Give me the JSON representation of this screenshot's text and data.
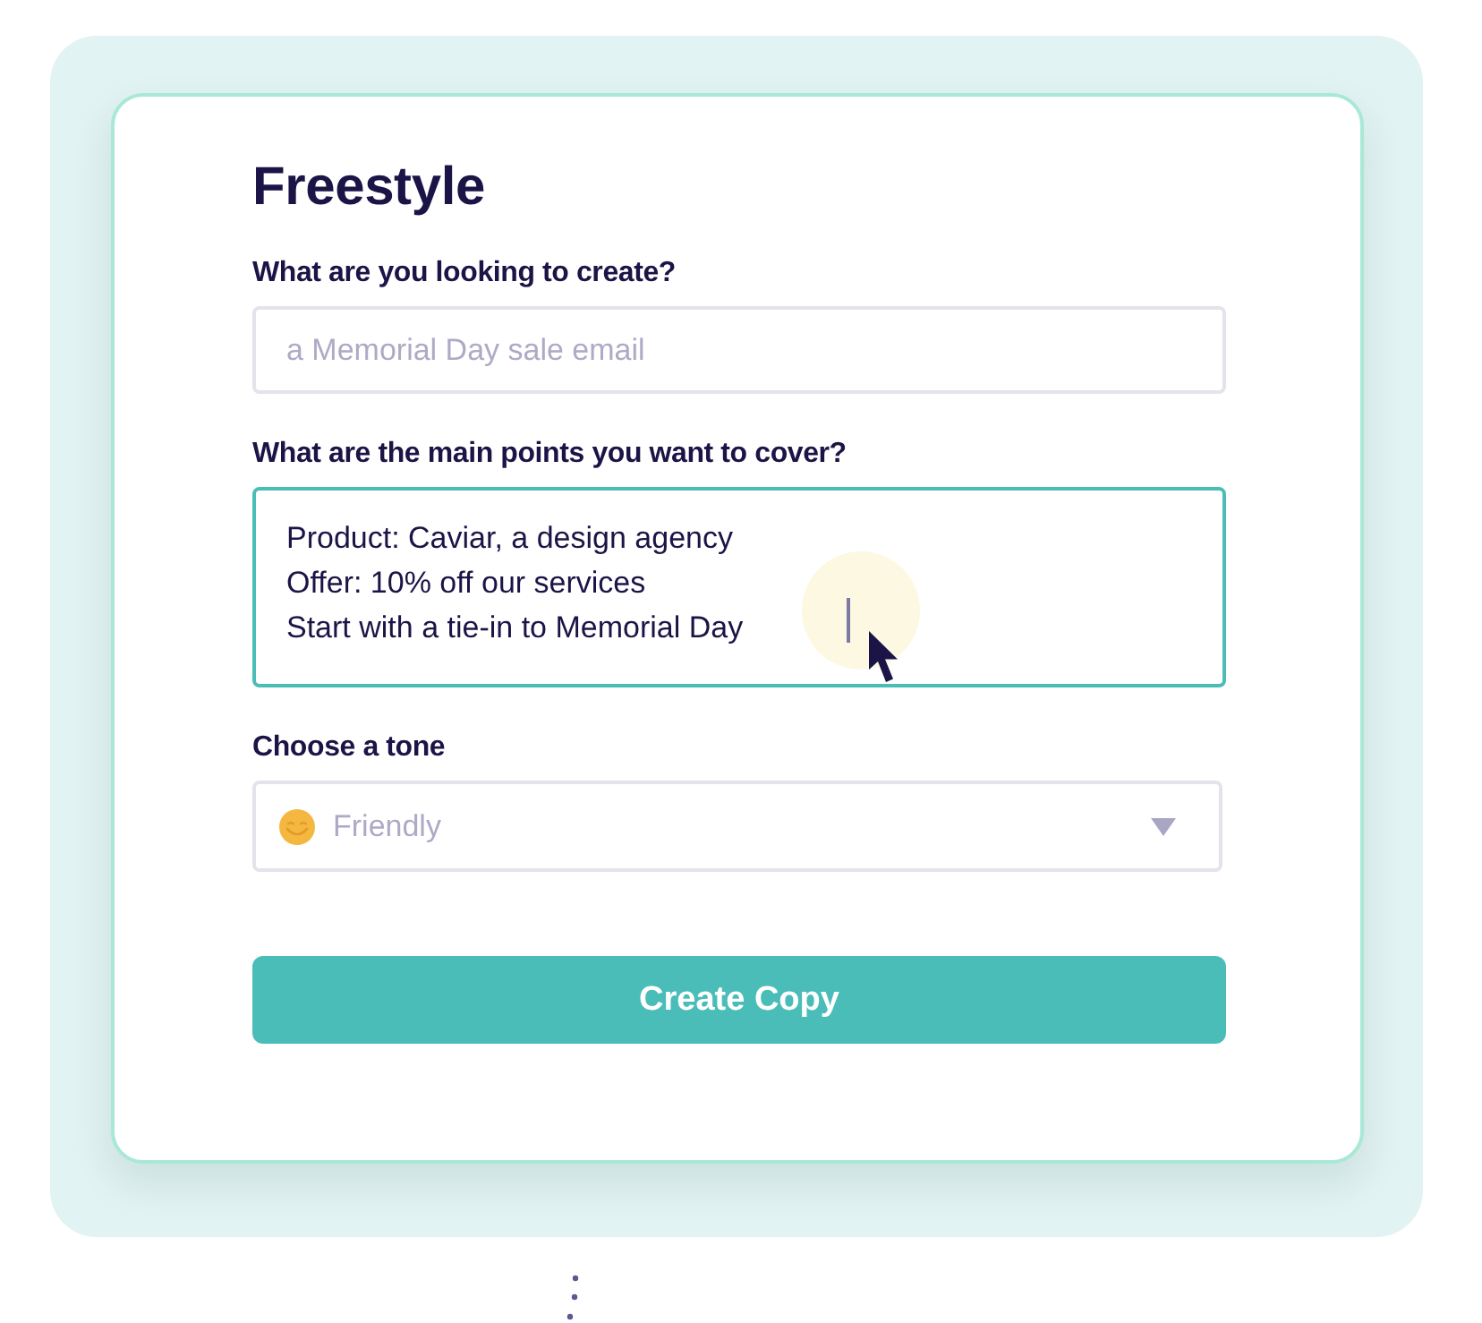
{
  "title": "Freestyle",
  "fields": [
    {
      "kind": "input",
      "label": "What are you looking to create?",
      "placeholder": "a Memorial Day sale email",
      "focused": false
    },
    {
      "kind": "textarea",
      "label": "What are the main points you want to cover?",
      "value": "Product: Caviar, a design agency\nOffer: 10% off our services\nStart with a tie-in to Memorial Day",
      "focused": true
    },
    {
      "kind": "select",
      "label": "Choose a tone",
      "value": "Friendly",
      "focused": false
    }
  ],
  "button": "Create Copy"
}
